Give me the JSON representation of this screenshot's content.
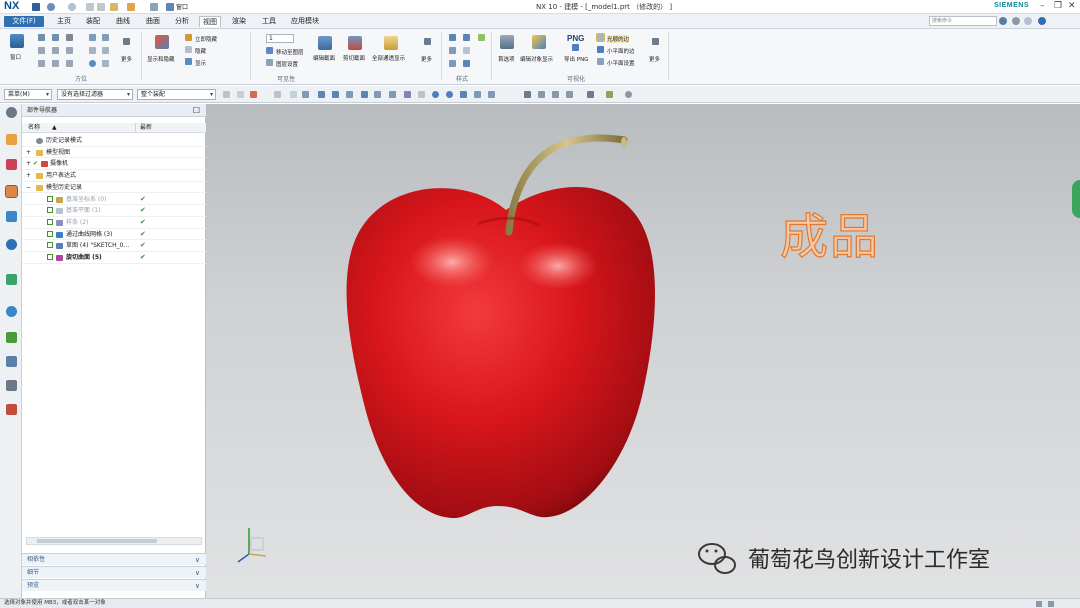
{
  "app": {
    "logo": "NX",
    "window_title": "NX 10 - 建模 - [_model1.prt （修改的） ]",
    "brand": "SIEMENS",
    "quick_window_label": "窗口",
    "search_placeholder": "搜索命令"
  },
  "menu": {
    "file": "文件(F)",
    "tabs": [
      "主页",
      "装配",
      "曲线",
      "曲面",
      "分析",
      "视图",
      "渲染",
      "工具",
      "应用模块"
    ],
    "active_tab": "视图"
  },
  "ribbon": {
    "groups": {
      "orient": "方位",
      "visibility": "可见性",
      "style": "样式",
      "visualization": "可视化"
    },
    "window_label": "窗口",
    "more": "更多",
    "show_hide": "显示和隐藏",
    "immediate_hide": "立即隐藏",
    "hide": "隐藏",
    "show": "显示",
    "layer_value": "1",
    "move_to_layer": "移动至图层",
    "layer_settings": "图层设置",
    "edit_section": "编辑截面",
    "clip_section": "剪切截面",
    "full_transparent": "全部通透显示",
    "preferences": "首选项",
    "edit_object_display": "编辑对象显示",
    "export_png_icon": "PNG",
    "export_png": "导出 PNG",
    "smooth_edges": "光顺的边",
    "small_flat_facets": "小平面的边",
    "small_facet_settings": "小平面设置"
  },
  "selection_bar": {
    "menu": "菜单(M)",
    "filter": "没有选择过滤器",
    "scope": "整个装配"
  },
  "navigator": {
    "title": "部件导航器",
    "col_name": "名称",
    "col_latest": "最新",
    "rows": [
      {
        "label": "历史记录模式",
        "style": "normal",
        "tick": ""
      },
      {
        "label": "模型视图",
        "style": "normal",
        "tick": ""
      },
      {
        "label": "摄像机",
        "style": "normal",
        "tick": ""
      },
      {
        "label": "用户表达式",
        "style": "normal",
        "tick": ""
      },
      {
        "label": "模型历史记录",
        "style": "normal",
        "tick": ""
      },
      {
        "label": "基准坐标系 (0)",
        "style": "gray",
        "tick": "✔"
      },
      {
        "label": "基准平面 (1)",
        "style": "gray",
        "tick": "✔"
      },
      {
        "label": "样条 (2)",
        "style": "gray",
        "tick": "✔"
      },
      {
        "label": "通过曲线网格 (3)",
        "style": "normal",
        "tick": "✔"
      },
      {
        "label": "草图 (4) \"SKETCH_0...",
        "style": "normal",
        "tick": "✔"
      },
      {
        "label": "旋切曲面 (5)",
        "style": "bold",
        "tick": "✔"
      }
    ],
    "folds": [
      "相依性",
      "细节",
      "预览"
    ]
  },
  "viewport": {
    "annotation": "成品",
    "watermark": "葡萄花鸟创新设计工作室",
    "apple_color": "#d8161b",
    "stem_color": "#b0a067"
  },
  "status": {
    "text": "选择对象并使用 MB3，或者双击某一对象"
  }
}
